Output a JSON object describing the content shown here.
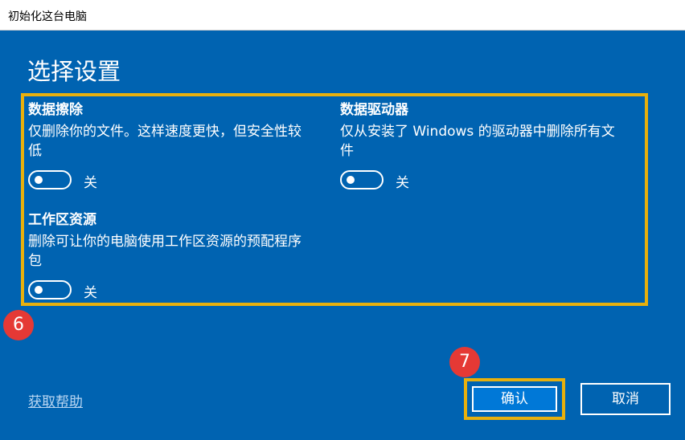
{
  "window": {
    "title": "初始化这台电脑"
  },
  "page": {
    "heading": "选择设置"
  },
  "options": [
    {
      "title": "数据擦除",
      "desc_line1": "仅删除你的文件。这样速度更快，但安全性较",
      "desc_line2": "低",
      "toggle_state": "关"
    },
    {
      "title": "数据驱动器",
      "desc_line1": "仅从安装了 Windows 的驱动器中删除所有文",
      "desc_line2": "件",
      "toggle_state": "关"
    },
    {
      "title": "工作区资源",
      "desc_line1": "删除可让你的电脑使用工作区资源的预配程序",
      "desc_line2": "包",
      "toggle_state": "关"
    }
  ],
  "annotations": {
    "badge_6": "6",
    "badge_7": "7"
  },
  "footer": {
    "help_link": "获取帮助",
    "confirm_label": "确认",
    "cancel_label": "取消"
  },
  "colors": {
    "background": "#0063b1",
    "highlight": "#e8b00d",
    "badge": "#e53935",
    "confirm_button": "#0078d7"
  }
}
